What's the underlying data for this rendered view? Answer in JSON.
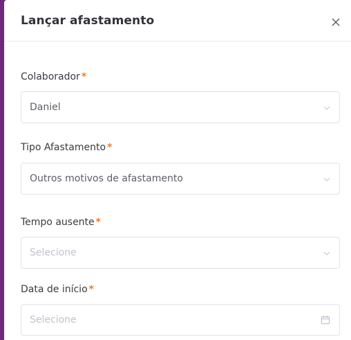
{
  "modal": {
    "title": "Lançar afastamento",
    "close_icon": "close-icon"
  },
  "fields": {
    "colaborador": {
      "label": "Colaborador",
      "required_mark": "*",
      "value": "Daniel",
      "icon": "chevron-down-icon"
    },
    "tipo": {
      "label": "Tipo Afastamento",
      "required_mark": "*",
      "value": "Outros motivos de afastamento",
      "icon": "chevron-down-icon"
    },
    "tempo": {
      "label": "Tempo ausente",
      "required_mark": "*",
      "placeholder": "Selecione",
      "icon": "chevron-down-icon"
    },
    "data_inicio": {
      "label": "Data de início",
      "required_mark": "*",
      "placeholder": "Selecione",
      "icon": "calendar-icon"
    }
  },
  "colors": {
    "backdrop": "#6e2a7a",
    "required": "#f47c20",
    "border": "#e3e3ea"
  }
}
